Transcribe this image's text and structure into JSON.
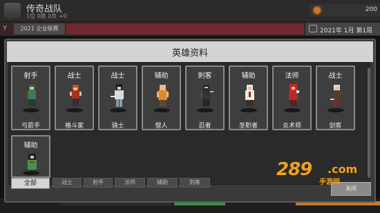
{
  "topbar": {
    "team_name": "传奇战队",
    "record": "1位 0胜 0负 +0",
    "coins": "200"
  },
  "subbar": {
    "league": "2021 企业联赛",
    "date": "2021年 1月 第1周"
  },
  "modal": {
    "title": "英雄资料",
    "close_label": "关闭",
    "heroes": [
      {
        "role": "射手",
        "name": "弓箭手"
      },
      {
        "role": "战士",
        "name": "格斗家"
      },
      {
        "role": "战士",
        "name": "骑士"
      },
      {
        "role": "辅助",
        "name": "僧人"
      },
      {
        "role": "刺客",
        "name": "忍者"
      },
      {
        "role": "辅助",
        "name": "圣职者"
      },
      {
        "role": "法师",
        "name": "炎术师"
      },
      {
        "role": "战士",
        "name": "剑客"
      },
      {
        "role": "辅助",
        "name": ""
      }
    ],
    "filters": [
      "全部",
      "战士",
      "射手",
      "法师",
      "辅助",
      "刺客"
    ]
  },
  "watermark": {
    "main": "289",
    "suffix": ".com",
    "sub": "手游网"
  },
  "colors": {
    "accent": "#f0a11e",
    "card_border": "#8a8a8a",
    "header": "#d4d4d4"
  }
}
